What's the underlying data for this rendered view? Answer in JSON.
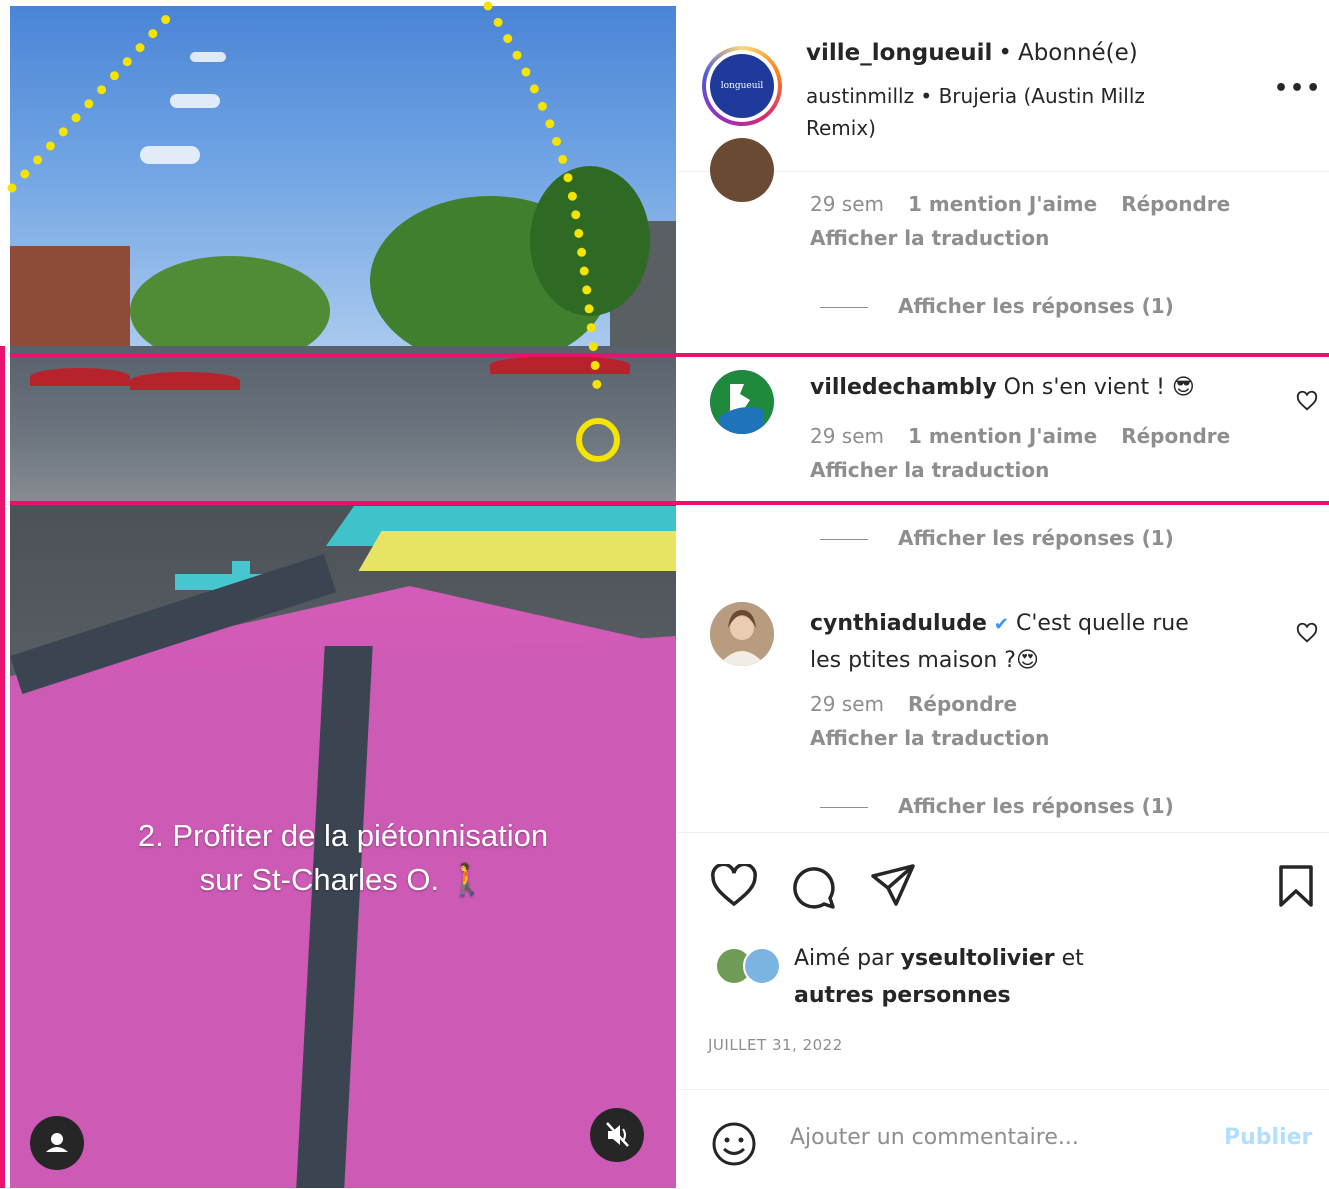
{
  "post": {
    "username": "ville_longueuil",
    "separator": "•",
    "follow_status": "Abonné(e)",
    "audio": "austinmillz • Brujeria (Austin Millz Remix)",
    "more_label": "•••",
    "avatar_logo_text": "longueuil"
  },
  "media": {
    "caption_line1": "2. Profiter de la piétonnisation",
    "caption_line2": "sur St-Charles O. 🚶"
  },
  "comments": [
    {
      "time": "29 sem",
      "likes": "1 mention J'aime",
      "reply_label": "Répondre",
      "translate_label": "Afficher la traduction",
      "replies_label": "Afficher les réponses (1)"
    },
    {
      "username": "villedechambly",
      "text": "On s'en vient ! 😎",
      "time": "29 sem",
      "likes": "1 mention J'aime",
      "reply_label": "Répondre",
      "translate_label": "Afficher la traduction",
      "replies_label": "Afficher les réponses (1)"
    },
    {
      "username": "cynthiadulude",
      "verified": "✔",
      "text_line1": "C'est quelle rue",
      "text_line2": "les ptites maison ?😍",
      "time": "29 sem",
      "reply_label": "Répondre",
      "translate_label": "Afficher la traduction",
      "replies_label": "Afficher les réponses (1)"
    }
  ],
  "actions": {
    "liked_prefix": "Aimé par",
    "liked_user": "yseultolivier",
    "liked_suffix": "et",
    "liked_others": "autres personnes",
    "date": "JUILLET 31, 2022"
  },
  "composer": {
    "placeholder": "Ajouter un commentaire...",
    "publish_label": "Publier"
  },
  "colors": {
    "highlight": "#e8126f",
    "trace": "#f5e400",
    "publish": "#b2dffc",
    "meta": "#8e8e8e"
  }
}
